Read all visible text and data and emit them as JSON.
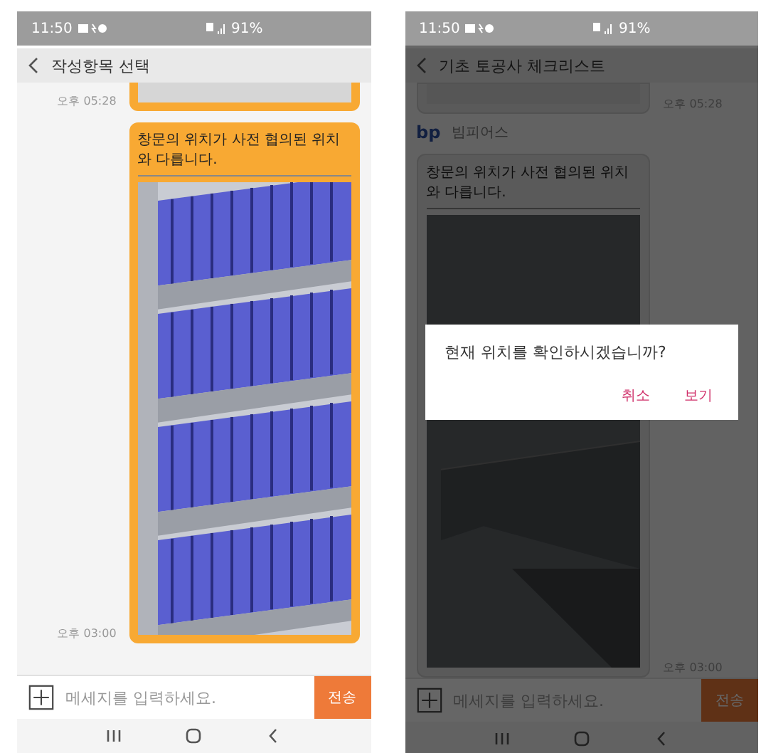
{
  "screens": [
    {
      "status_bar": {
        "time": "11:50",
        "battery": "91%"
      },
      "header": {
        "title": "작성항목 선택"
      },
      "dimmed": false,
      "messages": [
        {
          "outgoing": true,
          "partial": true,
          "time": "오후 05:28"
        },
        {
          "outgoing": true,
          "partial": false,
          "text": "창문의 위치가 사전 협의된 위치와 다릅니다.",
          "time": "오후 03:00"
        }
      ],
      "input": {
        "placeholder": "메세지를 입력하세요."
      },
      "send_button": "전송"
    },
    {
      "status_bar": {
        "time": "11:50",
        "battery": "91%"
      },
      "header": {
        "title": "기초 토공사 체크리스트"
      },
      "dimmed": true,
      "messages": [
        {
          "outgoing": false,
          "partial": true,
          "time": "오후 05:28"
        },
        {
          "outgoing": false,
          "partial": false,
          "sender": {
            "logo": "bp",
            "name": "빔피어스"
          },
          "text": "창문의 위치가 사전 협의된 위치와 다릅니다.",
          "time": "오후 03:00"
        }
      ],
      "input": {
        "placeholder": "메세지를 입력하세요."
      },
      "send_button": "전송",
      "dialog": {
        "message": "현재 위치를 확인하시겠습니까?",
        "buttons": [
          "취소",
          "보기"
        ]
      }
    }
  ]
}
